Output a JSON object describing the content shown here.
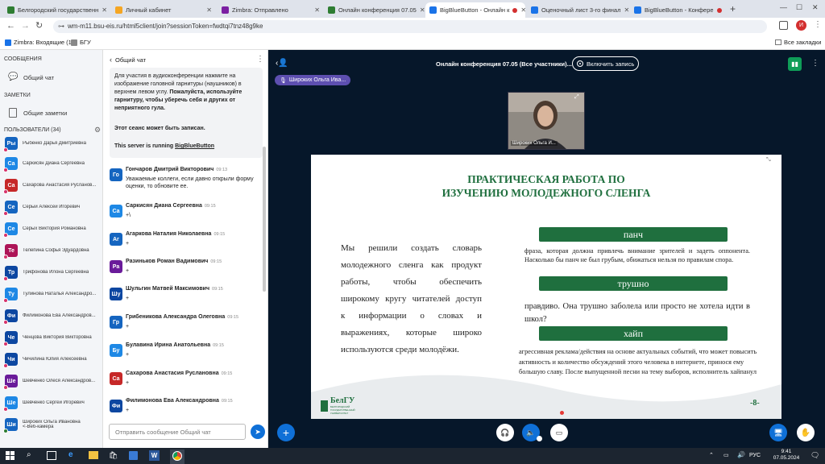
{
  "tabs": [
    {
      "label": "Белгородский государственн",
      "color": "#2e7d32"
    },
    {
      "label": "Личный кабинет",
      "color": "#f5a623"
    },
    {
      "label": "Zimbra: Отправлено",
      "color": "#7b1fa2"
    },
    {
      "label": "Онлайн конференция 07.05",
      "color": "#2e7d32"
    },
    {
      "label": "BigBlueButton - Онлайн к",
      "color": "#1a73e8"
    },
    {
      "label": "Оценочный лист 3-го финал",
      "color": "#1a73e8"
    },
    {
      "label": "BigBlueButton - Конфере",
      "color": "#1a73e8"
    }
  ],
  "address": {
    "url": "wm-m11.bsu-eis.ru/html5client/join?sessionToken=fwdtqi7tnz48g9ke"
  },
  "bookmarks": {
    "zimbra": "Zimbra: Входящие (1)",
    "bgu": "БГУ",
    "all": "Все закладки"
  },
  "sidebar": {
    "messages_header": "СООБЩЕНИЯ",
    "public_chat": "Общий чат",
    "notes_header": "ЗАМЕТКИ",
    "shared_notes": "Общие заметки",
    "users_header": "ПОЛЬЗОВАТЕЛИ (34)",
    "users": [
      {
        "initials": "Ры",
        "name": "Рыбенко Дарья Дмитриевна",
        "color": "#1565c0"
      },
      {
        "initials": "Са",
        "name": "Саркисян Диана Сергеевна",
        "color": "#1e88e5"
      },
      {
        "initials": "Са",
        "name": "Сахарова Анастасия Русланов...",
        "color": "#c62828"
      },
      {
        "initials": "Се",
        "name": "Серый Алексей Игоревич",
        "color": "#1565c0"
      },
      {
        "initials": "Се",
        "name": "Серых Виктория Романовна",
        "color": "#1e88e5"
      },
      {
        "initials": "Те",
        "name": "Телепина Софья Эдуардовна",
        "color": "#ad1457"
      },
      {
        "initials": "Тр",
        "name": "Трифонова Илона Сергеевна",
        "color": "#0d47a1"
      },
      {
        "initials": "Ту",
        "name": "Тулинова Наталья Александро...",
        "color": "#1e88e5"
      },
      {
        "initials": "Фи",
        "name": "Филимонова Ева Александров...",
        "color": "#0d47a1"
      },
      {
        "initials": "Че",
        "name": "Ченцова Виктория Викторовна",
        "color": "#0d47a1"
      },
      {
        "initials": "Чи",
        "name": "Чичилина Юлия Алексеевна",
        "color": "#0d47a1"
      },
      {
        "initials": "Ше",
        "name": "Шевченко Олеся Александров...",
        "color": "#6a1b9a"
      },
      {
        "initials": "Ше",
        "name": "Шевченко Сергей Игоревич",
        "color": "#1e88e5"
      },
      {
        "initials": "Ши",
        "name": "Широких Ольга Ивановна",
        "sub": "<-Веб-камера",
        "color": "#1565c0"
      }
    ]
  },
  "chat": {
    "header": "Общий чат",
    "welcome_1": "Для участия в аудиоконференции нажмите на изображение головной гарнитуры (наушников) в верхнем левом углу.",
    "welcome_2": "Пожалуйста, используйте гарнитуру, чтобы уберечь себя и других от неприятного гула.",
    "recording": "Этот сеанс может быть записан.",
    "server_prefix": "This server is running ",
    "server_link": "BigBlueButton",
    "messages": [
      {
        "initials": "Го",
        "name": "Гончаров Дмитрий Викторович",
        "time": "09:13",
        "text": "Уважаемые коллеги, если давно открыли форму оценки, то обновите ее.",
        "color": "#1565c0"
      },
      {
        "initials": "Са",
        "name": "Саркисян Диана Сергеевна",
        "time": "09:15",
        "text": "+\\",
        "color": "#1e88e5"
      },
      {
        "initials": "Аг",
        "name": "Агаркова Наталия Николаевна",
        "time": "09:15",
        "text": "+",
        "color": "#1565c0"
      },
      {
        "initials": "Ра",
        "name": "Разиньков Роман Вадимович",
        "time": "09:15",
        "text": "+",
        "color": "#6a1b9a"
      },
      {
        "initials": "Шу",
        "name": "Шульгин Матвей Максимович",
        "time": "09:15",
        "text": "+",
        "color": "#0d47a1"
      },
      {
        "initials": "Гр",
        "name": "Грибеникова Александра Олеговна",
        "time": "09:15",
        "text": "+",
        "color": "#1565c0"
      },
      {
        "initials": "Бу",
        "name": "Булавина Ирина Анатольевна",
        "time": "09:15",
        "text": "+",
        "color": "#1e88e5"
      },
      {
        "initials": "Са",
        "name": "Сахарова Анастасия Руслановна",
        "time": "09:15",
        "text": "+",
        "color": "#c62828"
      },
      {
        "initials": "Фи",
        "name": "Филимонова Ева Александровна",
        "time": "09:15",
        "text": "+",
        "color": "#0d47a1"
      }
    ],
    "input_placeholder": "Отправить сообщение Общий чат"
  },
  "meeting": {
    "title": "Онлайн конференция 07.05 (Все участники)...",
    "record": "Включить запись",
    "presenter": "Широких Ольга Ива...",
    "webcam_label": "Широких Ольга И..."
  },
  "slide": {
    "title_1": "ПРАКТИЧЕСКАЯ РАБОТА ПО",
    "title_2": "ИЗУЧЕНИЮ МОЛОДЕЖНОГО СЛЕНГА",
    "body_lines": [
      "Мы решили создать словарь",
      "молодежного сленга как продукт",
      "работы, чтобы обеспечить",
      "широкому кругу читателей доступ",
      "к информации о словах и",
      "выражениях, которые широко",
      "используются среди молодёжи."
    ],
    "term_1": "панч",
    "def_1": "фраза, которая должна привлечь внимание зрителей и задеть оппонента. Насколько бы панч не был грубым, обижаться нельзя по правилам спора.",
    "term_2": "трушно",
    "def_2": "правдиво. Она трушно заболела или просто не хотела идти в школ?",
    "term_3": "хайп",
    "def_3": "агрессивная реклама/действия на основе актуальных событий, что может повысить активность и количество обсуждений этого человека в интернете, принося ему большую славу. После выпущенной песни на тему выборов, исполнитель хайпанул",
    "logo": "БелГУ",
    "logo_sub": "БЕЛГОРОДСКИЙ ГОСУДАРСТВЕННЫЙ УНИВЕРСИТЕТ",
    "page": "-8-"
  },
  "taskbar": {
    "time": "9:41",
    "date": "07.05.2024",
    "lang": "РУС"
  },
  "colors": {
    "accent": "#1a73e8",
    "slide_green": "#1f6f3e",
    "bbb_blue": "#0f70d7",
    "dark": "#06172a"
  }
}
